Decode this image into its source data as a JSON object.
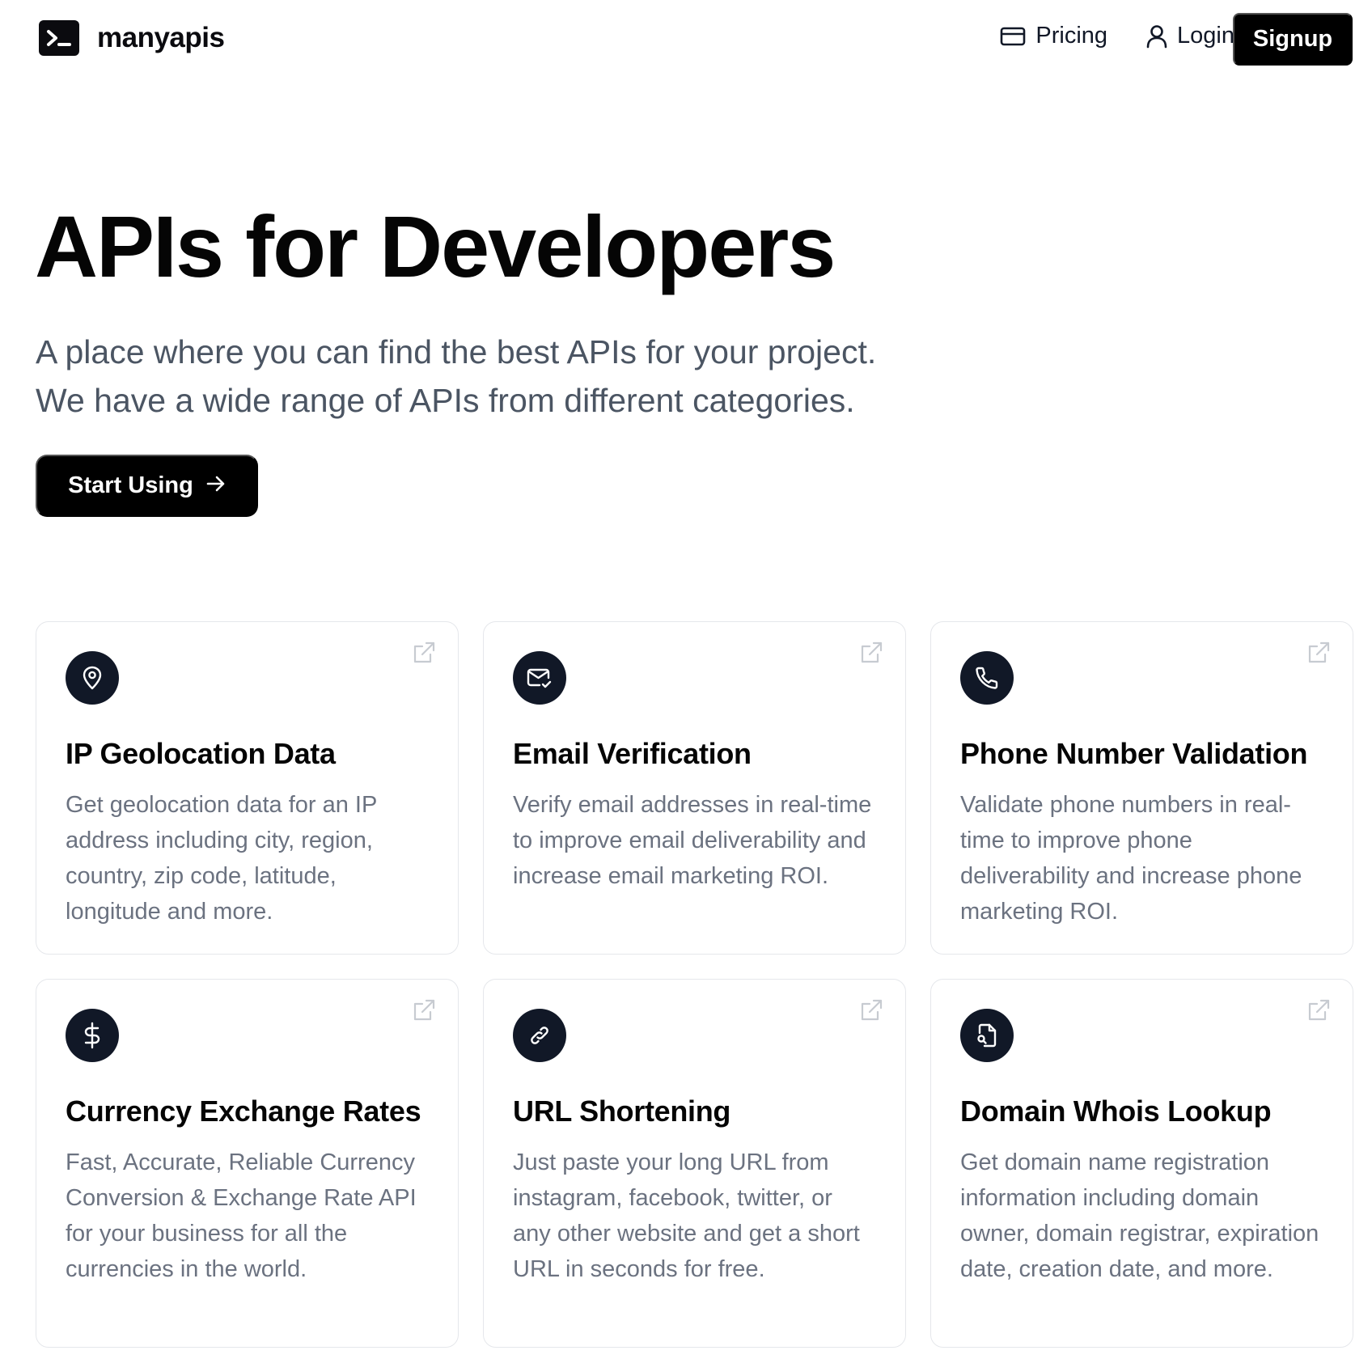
{
  "brand": {
    "name": "manyapis",
    "logo_icon": "terminal-icon"
  },
  "nav": {
    "pricing_label": "Pricing",
    "pricing_icon": "credit-card-icon",
    "login_label": "Login",
    "login_icon": "user-icon",
    "signup_label": "Signup"
  },
  "hero": {
    "title": "APIs for Developers",
    "subtitle_line1": "A place where you can find the best APIs for your project.",
    "subtitle_line2": "We have a wide range of APIs from different categories.",
    "cta_label": "Start Using",
    "cta_icon": "arrow-right-icon"
  },
  "cards": [
    {
      "title": "IP Geolocation Data",
      "description": "Get geolocation data for an IP address including city, region, country, zip code, latitude, longitude and more.",
      "icon": "map-pin-icon"
    },
    {
      "title": "Email Verification",
      "description": "Verify email addresses in real-time to improve email deliverability and increase email marketing ROI.",
      "icon": "mail-check-icon"
    },
    {
      "title": "Phone Number Validation",
      "description": "Validate phone numbers in real-time to improve phone deliverability and increase phone marketing ROI.",
      "icon": "phone-icon"
    },
    {
      "title": "Currency Exchange Rates",
      "description": "Fast, Accurate, Reliable Currency Conversion & Exchange Rate API for your business for all the currencies in the world.",
      "icon": "dollar-icon"
    },
    {
      "title": "URL Shortening",
      "description": "Just paste your long URL from instagram, facebook, twitter, or any other website and get a short URL in seconds for free.",
      "icon": "link-icon"
    },
    {
      "title": "Domain Whois Lookup",
      "description": "Get domain name registration information including domain owner, domain registrar, expiration date, creation date, and more.",
      "icon": "file-search-icon"
    }
  ],
  "colors": {
    "accent": "#000000",
    "icon_bg": "#111827",
    "muted_text": "#6b7280",
    "subtitle_text": "#4b5563",
    "card_border": "#e5e7eb"
  }
}
